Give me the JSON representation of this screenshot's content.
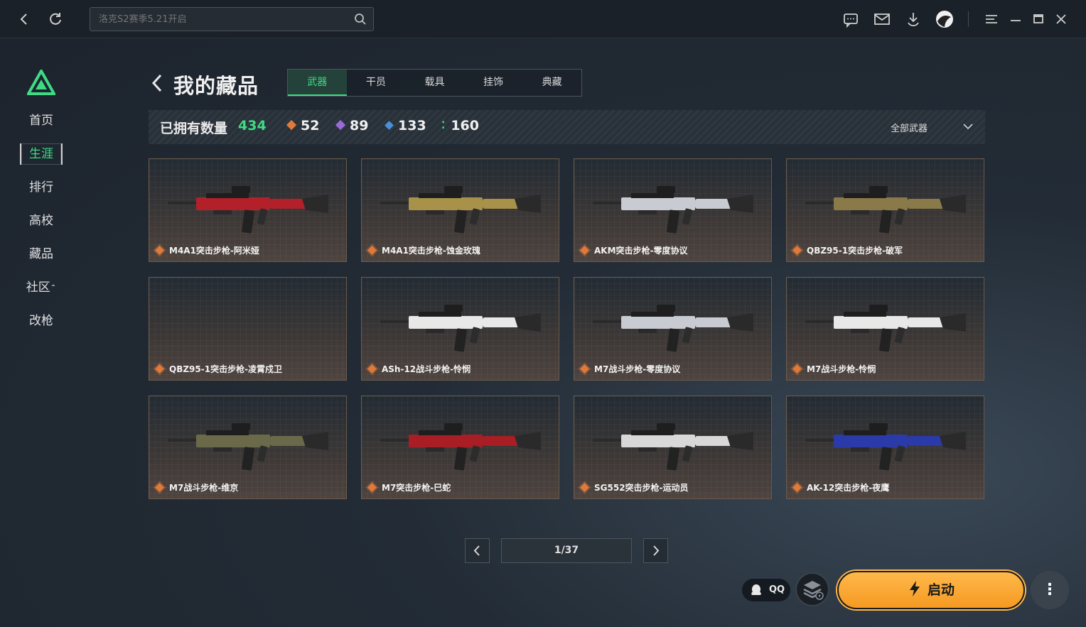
{
  "topbar": {
    "search_placeholder": "洛克S2赛季5.21开启",
    "icons": [
      "back-icon",
      "refresh-icon",
      "search-icon",
      "chat-icon",
      "mail-icon",
      "download-icon",
      "avatar",
      "menu-icon",
      "minimize-icon",
      "maximize-icon",
      "close-icon"
    ]
  },
  "sidebar": {
    "items": [
      {
        "label": "首页"
      },
      {
        "label": "生涯"
      },
      {
        "label": "排行"
      },
      {
        "label": "高校"
      },
      {
        "label": "藏品"
      },
      {
        "label": "社区"
      },
      {
        "label": "改枪"
      }
    ],
    "active_index": 1
  },
  "header": {
    "title": "我的藏品",
    "tabs": [
      {
        "label": "武器"
      },
      {
        "label": "干员"
      },
      {
        "label": "载具"
      },
      {
        "label": "挂饰"
      },
      {
        "label": "典藏"
      }
    ],
    "active_tab": 0
  },
  "stats": {
    "label": "已拥有数量",
    "total": "434",
    "counts": [
      {
        "value": "52",
        "color": "#e07a3a"
      },
      {
        "value": "89",
        "color": "#9a6ad8"
      },
      {
        "value": "133",
        "color": "#4a90d8"
      },
      {
        "value": "160",
        "color": "#3ddc84"
      }
    ],
    "filter": "全部武器"
  },
  "collection": [
    {
      "name": "M4A1突击步枪-阿米娅",
      "accent": "#b3202a",
      "rarity_color": "#e07a3a"
    },
    {
      "name": "M4A1突击步枪-蚀金玫瑰",
      "accent": "#a8924a",
      "rarity_color": "#e07a3a"
    },
    {
      "name": "AKM突击步枪-零度协议",
      "accent": "#c8ccd2",
      "rarity_color": "#e07a3a"
    },
    {
      "name": "QBZ95-1突击步枪-破军",
      "accent": "#8a7a4a",
      "rarity_color": "#e07a3a"
    },
    {
      "name": "QBZ95-1突击步枪-凌霄戍卫",
      "accent": "",
      "rarity_color": "#e07a3a"
    },
    {
      "name": "ASh-12战斗步枪-怜悯",
      "accent": "#e8e8e8",
      "rarity_color": "#e07a3a"
    },
    {
      "name": "M7战斗步枪-零度协议",
      "accent": "#c8ccd2",
      "rarity_color": "#e07a3a"
    },
    {
      "name": "M7战斗步枪-怜悯",
      "accent": "#e8e8e8",
      "rarity_color": "#e07a3a"
    },
    {
      "name": "M7战斗步枪-维京",
      "accent": "#6a6a4a",
      "rarity_color": "#e07a3a"
    },
    {
      "name": "M7突击步枪-巳蛇",
      "accent": "#a81e24",
      "rarity_color": "#e07a3a"
    },
    {
      "name": "SG552突击步枪-运动员",
      "accent": "#d8d8d8",
      "rarity_color": "#e07a3a"
    },
    {
      "name": "AK-12突击步枪-夜鹰",
      "accent": "#2a3aa8",
      "rarity_color": "#e07a3a"
    }
  ],
  "pagination": {
    "label": "1/37"
  },
  "bottom": {
    "qq_label": "QQ",
    "launch_label": "启动",
    "more_label": "⋮"
  },
  "colors": {
    "accent_green": "#3ddc84",
    "launch_orange": "#f59a22"
  }
}
